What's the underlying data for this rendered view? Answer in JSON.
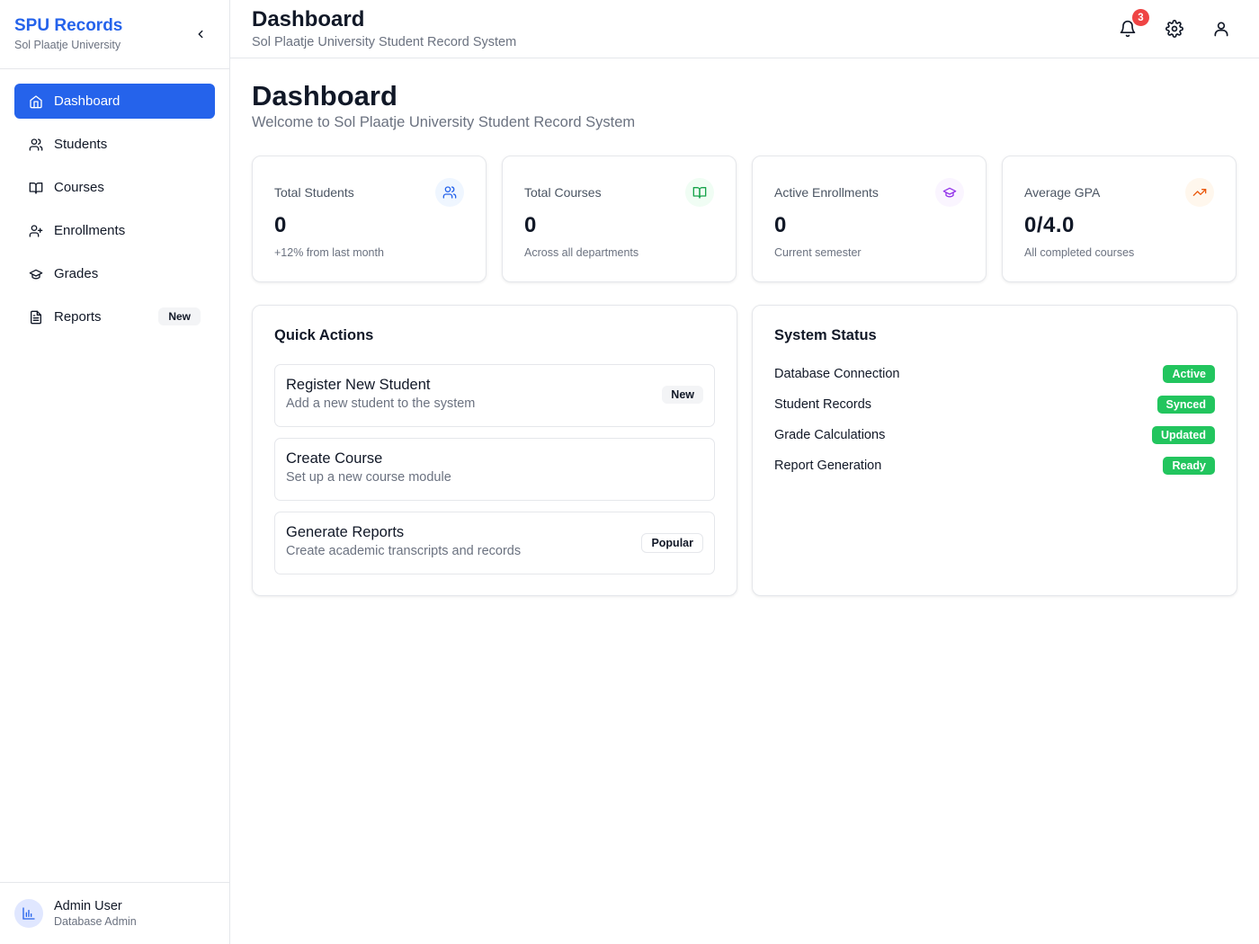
{
  "sidebar": {
    "brand_title": "SPU Records",
    "brand_subtitle": "Sol Plaatje University",
    "items": [
      {
        "label": "Dashboard",
        "icon": "home-icon",
        "active": true
      },
      {
        "label": "Students",
        "icon": "users-icon"
      },
      {
        "label": "Courses",
        "icon": "book-icon"
      },
      {
        "label": "Enrollments",
        "icon": "user-plus-icon"
      },
      {
        "label": "Grades",
        "icon": "graduation-cap-icon"
      },
      {
        "label": "Reports",
        "icon": "file-text-icon",
        "badge": "New"
      }
    ],
    "user": {
      "name": "Admin User",
      "role": "Database Admin"
    }
  },
  "header": {
    "title": "Dashboard",
    "subtitle": "Sol Plaatje University Student Record System",
    "notification_count": "3"
  },
  "main": {
    "title": "Dashboard",
    "subtitle": "Welcome to Sol Plaatje University Student Record System",
    "stats": [
      {
        "label": "Total Students",
        "value": "0",
        "note": "+12% from last month",
        "icon": "users-icon",
        "color": "#2563eb",
        "bg": "#eff6ff"
      },
      {
        "label": "Total Courses",
        "value": "0",
        "note": "Across all departments",
        "icon": "book-icon",
        "color": "#16a34a",
        "bg": "#f0fdf4"
      },
      {
        "label": "Active Enrollments",
        "value": "0",
        "note": "Current semester",
        "icon": "graduation-cap-icon",
        "color": "#9333ea",
        "bg": "#faf5ff"
      },
      {
        "label": "Average GPA",
        "value": "0/4.0",
        "note": "All completed courses",
        "icon": "trending-up-icon",
        "color": "#ea580c",
        "bg": "#fff7ed"
      }
    ],
    "quick_actions": {
      "title": "Quick Actions",
      "items": [
        {
          "title": "Register New Student",
          "desc": "Add a new student to the system",
          "badge": "New"
        },
        {
          "title": "Create Course",
          "desc": "Set up a new course module"
        },
        {
          "title": "Generate Reports",
          "desc": "Create academic transcripts and records",
          "badge": "Popular"
        }
      ]
    },
    "system_status": {
      "title": "System Status",
      "items": [
        {
          "label": "Database Connection",
          "status": "Active"
        },
        {
          "label": "Student Records",
          "status": "Synced"
        },
        {
          "label": "Grade Calculations",
          "status": "Updated"
        },
        {
          "label": "Report Generation",
          "status": "Ready"
        }
      ],
      "status_color": "#22c55e"
    }
  },
  "colors": {
    "accent": "#2563eb",
    "success": "#22c55e",
    "danger": "#ef4444"
  }
}
